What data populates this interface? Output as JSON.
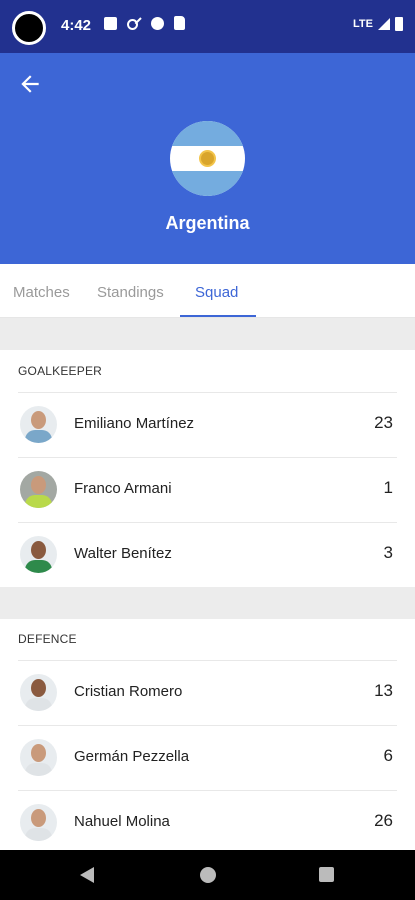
{
  "status_bar": {
    "time": "4:42",
    "network": "LTE",
    "icons": [
      "notification-square-icon",
      "key-icon",
      "circle-app-icon",
      "sd-card-icon",
      "signal-icon",
      "battery-icon"
    ]
  },
  "header": {
    "back_icon": "arrow-left-icon",
    "team_name": "Argentina",
    "colors": {
      "background": "#3d66d6",
      "status_bar": "#22318f"
    }
  },
  "tabs": [
    {
      "label": "Matches",
      "active": false
    },
    {
      "label": "Standings",
      "active": false
    },
    {
      "label": "Squad",
      "active": true
    }
  ],
  "sections": [
    {
      "title": "GOALKEEPER",
      "players": [
        {
          "name": "Emiliano Martínez",
          "number": "23"
        },
        {
          "name": "Franco Armani",
          "number": "1"
        },
        {
          "name": "Walter Benítez",
          "number": "3"
        }
      ]
    },
    {
      "title": "DEFENCE",
      "players": [
        {
          "name": "Cristian Romero",
          "number": "13"
        },
        {
          "name": "Germán Pezzella",
          "number": "6"
        },
        {
          "name": "Nahuel Molina",
          "number": "26"
        }
      ]
    }
  ],
  "nav_bar": {
    "icons": [
      "nav-back-icon",
      "nav-home-icon",
      "nav-recent-icon"
    ]
  }
}
